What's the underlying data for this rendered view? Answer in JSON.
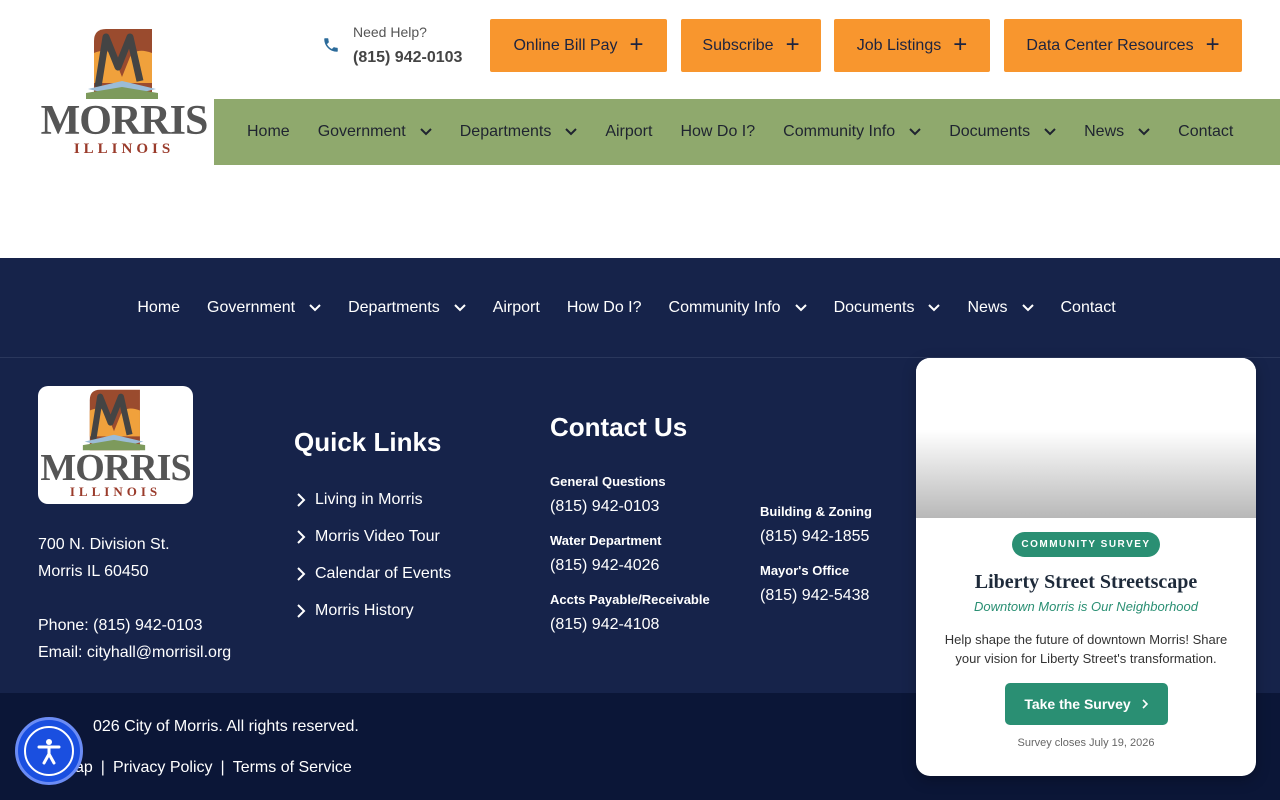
{
  "header": {
    "logo": {
      "word": "MORRIS",
      "sub": "ILLINOIS"
    },
    "help": {
      "label": "Need Help?",
      "phone": "(815) 942-0103"
    },
    "utility_buttons": [
      {
        "label": "Online Bill Pay"
      },
      {
        "label": "Subscribe"
      },
      {
        "label": "Job Listings"
      },
      {
        "label": "Data Center Resources"
      }
    ],
    "nav": [
      {
        "label": "Home",
        "dropdown": false
      },
      {
        "label": "Government",
        "dropdown": true
      },
      {
        "label": "Departments",
        "dropdown": true
      },
      {
        "label": "Airport",
        "dropdown": false
      },
      {
        "label": "How Do I?",
        "dropdown": false
      },
      {
        "label": "Community Info",
        "dropdown": true
      },
      {
        "label": "Documents",
        "dropdown": true
      },
      {
        "label": "News",
        "dropdown": true
      },
      {
        "label": "Contact",
        "dropdown": false
      }
    ]
  },
  "footer": {
    "nav": [
      {
        "label": "Home",
        "dropdown": false
      },
      {
        "label": "Government",
        "dropdown": true
      },
      {
        "label": "Departments",
        "dropdown": true
      },
      {
        "label": "Airport",
        "dropdown": false
      },
      {
        "label": "How Do I?",
        "dropdown": false
      },
      {
        "label": "Community Info",
        "dropdown": true
      },
      {
        "label": "Documents",
        "dropdown": true
      },
      {
        "label": "News",
        "dropdown": true
      },
      {
        "label": "Contact",
        "dropdown": false
      }
    ],
    "logo": {
      "word": "MORRIS",
      "sub": "ILLINOIS"
    },
    "address": {
      "line1": "700 N. Division St.",
      "line2": "Morris IL 60450",
      "phone": "Phone: (815) 942-0103",
      "email": "Email: cityhall@morrisil.org"
    },
    "quick_links": {
      "title": "Quick Links",
      "items": [
        "Living in Morris",
        "Morris Video Tour",
        "Calendar of Events",
        "Morris History"
      ]
    },
    "contact": {
      "title": "Contact Us",
      "entries": [
        {
          "label": "General Questions",
          "phone": "(815) 942-0103"
        },
        {
          "label": "Water Department",
          "phone": "(815) 942-4026"
        },
        {
          "label": "Accts Payable/Receivable",
          "phone": "(815) 942-4108"
        },
        {
          "label": "Building & Zoning",
          "phone": "(815) 942-1855"
        },
        {
          "label": "Mayor's Office",
          "phone": "(815) 942-5438"
        }
      ]
    },
    "copyright": "026 City of Morris. All rights reserved.",
    "legal": {
      "sitemap": "ap",
      "sep1": "|",
      "privacy": "Privacy Policy",
      "sep2": "|",
      "terms": "Terms of Service"
    }
  },
  "survey_card": {
    "badge": "COMMUNITY SURVEY",
    "title": "Liberty Street Streetscape",
    "subtitle": "Downtown Morris is Our Neighborhood",
    "description": "Help shape the future of downtown Morris! Share your vision for Liberty Street's transformation.",
    "button": "Take the Survey",
    "note": "Survey closes July 19, 2026"
  },
  "colors": {
    "utility_orange": "#f8962e",
    "nav_green": "#8fa96d",
    "footer_navy": "#16234a",
    "bottom_navy": "#0b1637",
    "survey_green": "#2a8f73",
    "a11y_blue": "#1a4fe0"
  },
  "icons": [
    "phone-icon",
    "plus-icon",
    "chevron-down-icon",
    "chevron-right-icon",
    "accessibility-icon",
    "morris-logo"
  ]
}
